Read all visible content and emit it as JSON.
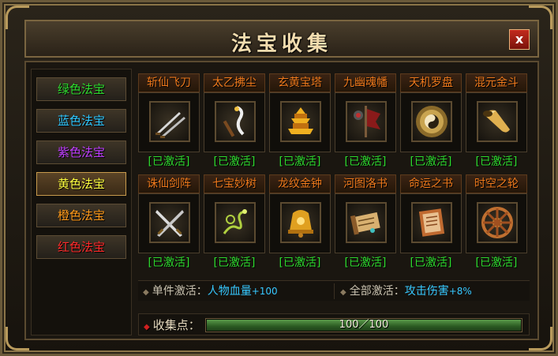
{
  "window": {
    "title": "法宝收集",
    "close_label": "x"
  },
  "sidebar": {
    "tabs": [
      {
        "label": "绿色法宝",
        "color": "#2fdc2f"
      },
      {
        "label": "蓝色法宝",
        "color": "#30c8ff"
      },
      {
        "label": "紫色法宝",
        "color": "#c040ff"
      },
      {
        "label": "黄色法宝",
        "color": "#ffff40"
      },
      {
        "label": "橙色法宝",
        "color": "#ff9a1a"
      },
      {
        "label": "红色法宝",
        "color": "#ff2a2a"
      }
    ],
    "active_tab": 3
  },
  "treasures": [
    {
      "name": "斩仙飞刀",
      "status": "[已激活]",
      "icon": "twin-blades-icon"
    },
    {
      "name": "太乙拂尘",
      "status": "[已激活]",
      "icon": "whisk-icon"
    },
    {
      "name": "玄黄宝塔",
      "status": "[已激活]",
      "icon": "pagoda-icon"
    },
    {
      "name": "九幽魂幡",
      "status": "[已激活]",
      "icon": "soul-banner-icon"
    },
    {
      "name": "天机罗盘",
      "status": "[已激活]",
      "icon": "yin-yang-disc-icon"
    },
    {
      "name": "混元金斗",
      "status": "[已激活]",
      "icon": "horn-icon"
    },
    {
      "name": "诛仙剑阵",
      "status": "[已激活]",
      "icon": "crossed-swords-icon"
    },
    {
      "name": "七宝妙树",
      "status": "[已激活]",
      "icon": "vine-branch-icon"
    },
    {
      "name": "龙纹金钟",
      "status": "[已激活]",
      "icon": "golden-bell-icon"
    },
    {
      "name": "河图洛书",
      "status": "[已激活]",
      "icon": "scroll-icon"
    },
    {
      "name": "命运之书",
      "status": "[已激活]",
      "icon": "book-icon"
    },
    {
      "name": "时空之轮",
      "status": "[已激活]",
      "icon": "wheel-icon"
    }
  ],
  "bonus": {
    "single_label": "单件激活：",
    "single_stat": "人物血量",
    "single_value": "+100",
    "all_label": "全部激活：",
    "all_stat": "攻击伤害",
    "all_value": "+8%"
  },
  "collection": {
    "label": "收集点：",
    "current": 100,
    "max": 100,
    "progress_text": "100／100"
  }
}
